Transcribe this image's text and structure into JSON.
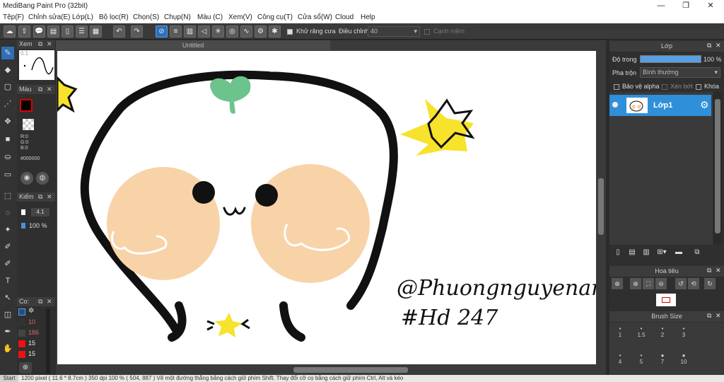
{
  "app": {
    "title": "MediBang Paint Pro (32bit)"
  },
  "menu": [
    "Tệp(F)",
    "Chỉnh sửa(E)",
    "Lớp(L)",
    "Bộ lọc(R)",
    "Chọn(S)",
    "Chụp(N)",
    "Màu (C)",
    "Xem(V)",
    "Công cụ(T)",
    "Cửa sổ(W)",
    "Cloud",
    "Help"
  ],
  "toolbar": {
    "antialias_label": "Khử răng cưa",
    "adjust_label": "Điều chỉnh",
    "adjust_value": "40",
    "sharp_label": "Cạnh mềm"
  },
  "left": {
    "nav_title": "Xem",
    "nav_zoom": "0.1",
    "color_title": "Màu",
    "rgb": [
      "R:0",
      "G:0",
      "B:0"
    ],
    "hex": "#000000",
    "check_title": "Kiểm",
    "brush_size": "4.1",
    "opacity": "100 %",
    "color_list_title": "Co:",
    "color_list": [
      "10",
      "186",
      "15",
      "15"
    ]
  },
  "canvas": {
    "tab_title": "Untitled",
    "signature_line1": "@Phuongnguyenanh",
    "signature_line2": "#Hd 247"
  },
  "layers": {
    "title": "Lớp",
    "opacity_label": "Độ trong",
    "opacity_value": "100 %",
    "blend_label": "Pha trộn",
    "blend_value": "Bình thường",
    "protect_alpha": "Bảo vệ alpha",
    "clipping": "Xén bớt",
    "lock": "Khóa",
    "layer_name": "Lớp1"
  },
  "navigator": {
    "title": "Hoa tiêu"
  },
  "brush_size": {
    "title": "Brush Size",
    "sizes": [
      "1",
      "1.5",
      "2",
      "3",
      "4",
      "5",
      "7",
      "10"
    ]
  },
  "status": {
    "start": "Start",
    "text": "1200 pixel  ( 11.6 * 8.7cm )  350 dpi  100 %  ( 504, 887 )  Vẽ một đường thẳng bằng cách giữ phím Shift. Thay đổi cỡ cọ bằng cách giữ phím Ctrl, Alt và kéo"
  },
  "colors": {
    "accent": "#2f6fb7",
    "cheek": "#f8d3a8",
    "leaf": "#6cc38c",
    "star": "#f7e22c"
  }
}
